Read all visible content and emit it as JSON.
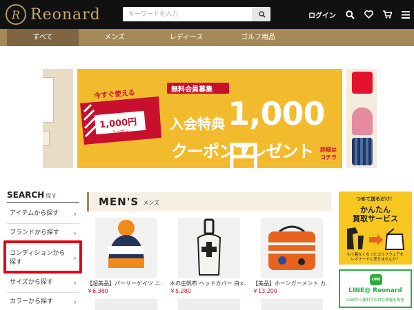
{
  "header": {
    "logo_mark": "R",
    "logo_text": "Reonard",
    "search_placeholder": "キーワードを入力",
    "login_label": "ログイン"
  },
  "nav": {
    "items": [
      "すべて",
      "メンズ",
      "レディース",
      "ゴルフ用品"
    ]
  },
  "banner": {
    "badge_top": "今すぐ使える",
    "coupon_value": "1,000円",
    "coupon_sub": "クーポン",
    "member_badge": "無料会員募集",
    "headline_prefix": "入会特典",
    "headline_value": "1,000円",
    "headline_sub": "クーポンプレゼント",
    "detail_line1": "詳細は",
    "detail_line2": "コチラ"
  },
  "sidebar": {
    "title": "SEARCH",
    "title_sub": "探す",
    "items": [
      {
        "label": "アイテムから探す"
      },
      {
        "label": "ブランドから探す"
      },
      {
        "label": "コンディションから探す"
      },
      {
        "label": "サイズから探す"
      },
      {
        "label": "カラーから探す"
      }
    ]
  },
  "main": {
    "section_title": "MEN'S",
    "section_sub": "メンズ",
    "products": [
      {
        "name": "【超美品】パーリーゲイツ ニ…",
        "price": "￥6,380"
      },
      {
        "name": "木の庄帆布 ヘッドカバー 白×…",
        "price": "￥5,280"
      },
      {
        "name": "【美品】ホーンガーメント カ…",
        "price": "￥13,200"
      }
    ]
  },
  "ads": {
    "buy_top": "つめて送るだけ！",
    "buy_title1": "かんたん",
    "buy_title2": "買取サービス",
    "buy_note1": "もう着なくなったゴルフウェアを",
    "buy_note2": "レオナードに売りませんか？",
    "line_logo": "LINE",
    "line_title": "LINE@ Reonard",
    "line_note": "LINEから便利でお得な情報を配信"
  },
  "colors": {
    "header_bg": "#111111",
    "nav_bg": "#a58858",
    "nav_active": "#7f6541",
    "banner_yellow": "#f2bb2e",
    "coupon_red": "#c8102e",
    "price_red": "#d0021b",
    "highlight_red": "#e50012",
    "line_green": "#2cae3f"
  }
}
